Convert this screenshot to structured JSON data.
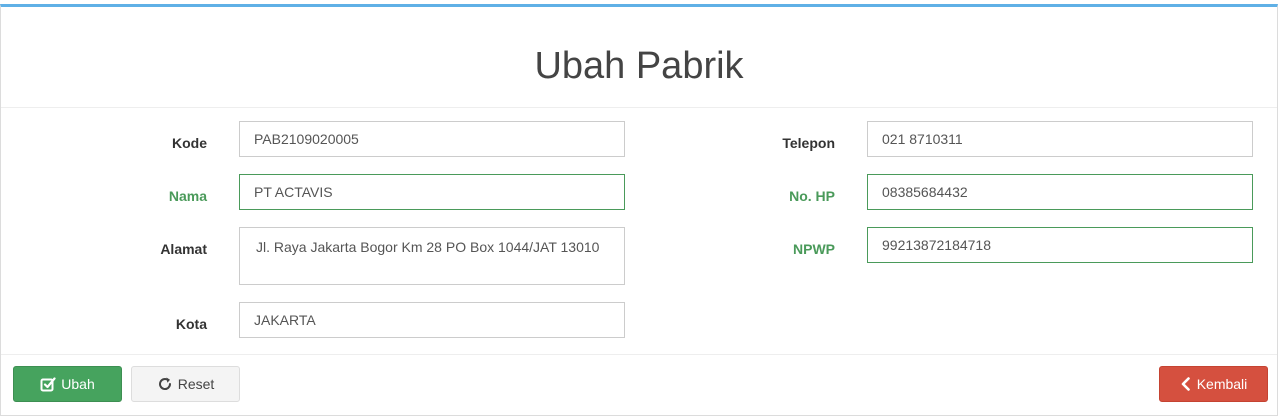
{
  "page": {
    "title": "Ubah Pabrik"
  },
  "form": {
    "left": [
      {
        "label": "Kode",
        "value": "PAB2109020005",
        "state": "default"
      },
      {
        "label": "Nama",
        "value": "PT ACTAVIS",
        "state": "success"
      },
      {
        "label": "Alamat",
        "value": "Jl. Raya Jakarta Bogor Km 28 PO Box 1044/JAT 13010",
        "state": "default"
      },
      {
        "label": "Kota",
        "value": "JAKARTA",
        "state": "default"
      }
    ],
    "right": [
      {
        "label": "Telepon",
        "value": "021 8710311",
        "state": "default"
      },
      {
        "label": "No. HP",
        "value": "08385684432",
        "state": "success"
      },
      {
        "label": "NPWP",
        "value": "99213872184718",
        "state": "success"
      }
    ]
  },
  "footer": {
    "save_label": "Ubah",
    "reset_label": "Reset",
    "back_label": "Kembali"
  },
  "colors": {
    "accent_top": "#5fb0e6",
    "success": "#46a35e",
    "danger": "#d5503f"
  },
  "icons": {
    "save": "edit-check-icon",
    "reset": "refresh-icon",
    "back": "chevron-left-icon"
  }
}
